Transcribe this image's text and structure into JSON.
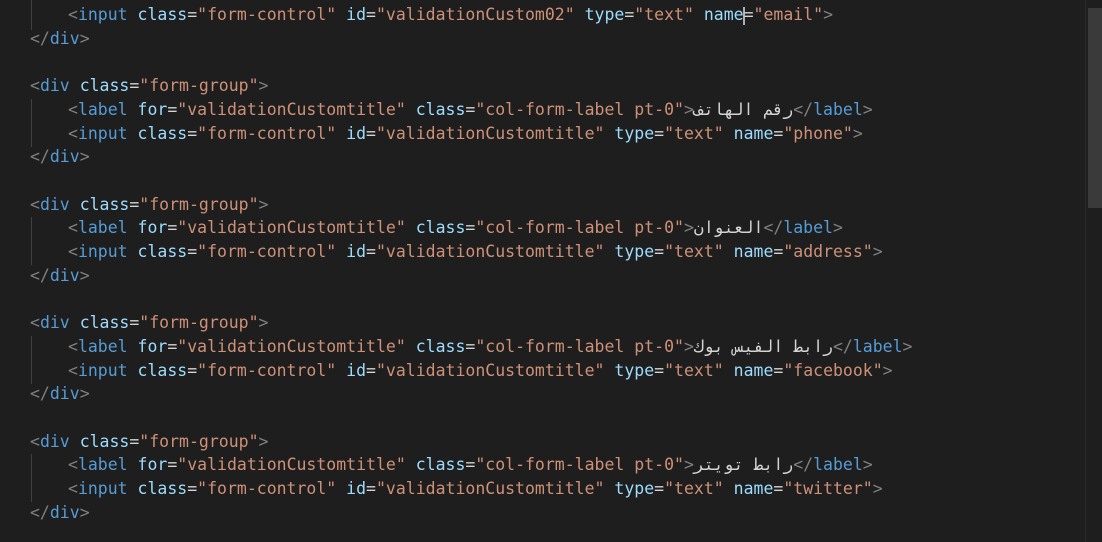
{
  "editor": {
    "theme_colors": {
      "background": "#1e1e1e",
      "tag": "#569cd6",
      "attribute": "#9cdcfe",
      "string": "#ce9178",
      "punctuation": "#808080",
      "text": "#d4d4d4"
    },
    "lines": [
      {
        "indent": 1,
        "parts": [
          [
            "punct",
            "<"
          ],
          [
            "tag",
            "input"
          ],
          [
            "text",
            " "
          ],
          [
            "attr",
            "class"
          ],
          [
            "eq",
            "="
          ],
          [
            "str",
            "\"form-control\""
          ],
          [
            "text",
            " "
          ],
          [
            "attr",
            "id"
          ],
          [
            "eq",
            "="
          ],
          [
            "str",
            "\"validationCustom02\""
          ],
          [
            "text",
            " "
          ],
          [
            "attr",
            "type"
          ],
          [
            "eq",
            "="
          ],
          [
            "str",
            "\"text\""
          ],
          [
            "text",
            " "
          ],
          [
            "attr",
            "name"
          ],
          [
            "eq",
            "="
          ],
          [
            "str",
            "\"email\""
          ],
          [
            "punct",
            ">"
          ]
        ]
      },
      {
        "indent": 0,
        "parts": [
          [
            "punct",
            "</"
          ],
          [
            "tag",
            "div"
          ],
          [
            "punct",
            ">"
          ]
        ]
      },
      {
        "indent": 0,
        "parts": []
      },
      {
        "indent": 0,
        "parts": [
          [
            "punct",
            "<"
          ],
          [
            "tag",
            "div"
          ],
          [
            "text",
            " "
          ],
          [
            "attr",
            "class"
          ],
          [
            "eq",
            "="
          ],
          [
            "str",
            "\"form-group\""
          ],
          [
            "punct",
            ">"
          ]
        ]
      },
      {
        "indent": 1,
        "parts": [
          [
            "punct",
            "<"
          ],
          [
            "tag",
            "label"
          ],
          [
            "text",
            " "
          ],
          [
            "attr",
            "for"
          ],
          [
            "eq",
            "="
          ],
          [
            "str",
            "\"validationCustomtitle\""
          ],
          [
            "text",
            " "
          ],
          [
            "attr",
            "class"
          ],
          [
            "eq",
            "="
          ],
          [
            "str",
            "\"col-form-label pt-0\""
          ],
          [
            "punct",
            ">"
          ],
          [
            "text",
            "رقم الهاتف"
          ],
          [
            "punct",
            "</"
          ],
          [
            "tag",
            "label"
          ],
          [
            "punct",
            ">"
          ]
        ]
      },
      {
        "indent": 1,
        "parts": [
          [
            "punct",
            "<"
          ],
          [
            "tag",
            "input"
          ],
          [
            "text",
            " "
          ],
          [
            "attr",
            "class"
          ],
          [
            "eq",
            "="
          ],
          [
            "str",
            "\"form-control\""
          ],
          [
            "text",
            " "
          ],
          [
            "attr",
            "id"
          ],
          [
            "eq",
            "="
          ],
          [
            "str",
            "\"validationCustomtitle\""
          ],
          [
            "text",
            " "
          ],
          [
            "attr",
            "type"
          ],
          [
            "eq",
            "="
          ],
          [
            "str",
            "\"text\""
          ],
          [
            "text",
            " "
          ],
          [
            "attr",
            "name"
          ],
          [
            "eq",
            "="
          ],
          [
            "str",
            "\"phone\""
          ],
          [
            "punct",
            ">"
          ]
        ]
      },
      {
        "indent": 0,
        "parts": [
          [
            "punct",
            "</"
          ],
          [
            "tag",
            "div"
          ],
          [
            "punct",
            ">"
          ]
        ]
      },
      {
        "indent": 0,
        "parts": []
      },
      {
        "indent": 0,
        "parts": [
          [
            "punct",
            "<"
          ],
          [
            "tag",
            "div"
          ],
          [
            "text",
            " "
          ],
          [
            "attr",
            "class"
          ],
          [
            "eq",
            "="
          ],
          [
            "str",
            "\"form-group\""
          ],
          [
            "punct",
            ">"
          ]
        ]
      },
      {
        "indent": 1,
        "parts": [
          [
            "punct",
            "<"
          ],
          [
            "tag",
            "label"
          ],
          [
            "text",
            " "
          ],
          [
            "attr",
            "for"
          ],
          [
            "eq",
            "="
          ],
          [
            "str",
            "\"validationCustomtitle\""
          ],
          [
            "text",
            " "
          ],
          [
            "attr",
            "class"
          ],
          [
            "eq",
            "="
          ],
          [
            "str",
            "\"col-form-label pt-0\""
          ],
          [
            "punct",
            ">"
          ],
          [
            "text",
            "العنوان"
          ],
          [
            "punct",
            "</"
          ],
          [
            "tag",
            "label"
          ],
          [
            "punct",
            ">"
          ]
        ]
      },
      {
        "indent": 1,
        "parts": [
          [
            "punct",
            "<"
          ],
          [
            "tag",
            "input"
          ],
          [
            "text",
            " "
          ],
          [
            "attr",
            "class"
          ],
          [
            "eq",
            "="
          ],
          [
            "str",
            "\"form-control\""
          ],
          [
            "text",
            " "
          ],
          [
            "attr",
            "id"
          ],
          [
            "eq",
            "="
          ],
          [
            "str",
            "\"validationCustomtitle\""
          ],
          [
            "text",
            " "
          ],
          [
            "attr",
            "type"
          ],
          [
            "eq",
            "="
          ],
          [
            "str",
            "\"text\""
          ],
          [
            "text",
            " "
          ],
          [
            "attr",
            "name"
          ],
          [
            "eq",
            "="
          ],
          [
            "str",
            "\"address\""
          ],
          [
            "punct",
            ">"
          ]
        ]
      },
      {
        "indent": 0,
        "parts": [
          [
            "punct",
            "</"
          ],
          [
            "tag",
            "div"
          ],
          [
            "punct",
            ">"
          ]
        ]
      },
      {
        "indent": 0,
        "parts": []
      },
      {
        "indent": 0,
        "parts": [
          [
            "punct",
            "<"
          ],
          [
            "tag",
            "div"
          ],
          [
            "text",
            " "
          ],
          [
            "attr",
            "class"
          ],
          [
            "eq",
            "="
          ],
          [
            "str",
            "\"form-group\""
          ],
          [
            "punct",
            ">"
          ]
        ]
      },
      {
        "indent": 1,
        "parts": [
          [
            "punct",
            "<"
          ],
          [
            "tag",
            "label"
          ],
          [
            "text",
            " "
          ],
          [
            "attr",
            "for"
          ],
          [
            "eq",
            "="
          ],
          [
            "str",
            "\"validationCustomtitle\""
          ],
          [
            "text",
            " "
          ],
          [
            "attr",
            "class"
          ],
          [
            "eq",
            "="
          ],
          [
            "str",
            "\"col-form-label pt-0\""
          ],
          [
            "punct",
            ">"
          ],
          [
            "text",
            "رابط الفيس بوك"
          ],
          [
            "punct",
            "</"
          ],
          [
            "tag",
            "label"
          ],
          [
            "punct",
            ">"
          ]
        ]
      },
      {
        "indent": 1,
        "parts": [
          [
            "punct",
            "<"
          ],
          [
            "tag",
            "input"
          ],
          [
            "text",
            " "
          ],
          [
            "attr",
            "class"
          ],
          [
            "eq",
            "="
          ],
          [
            "str",
            "\"form-control\""
          ],
          [
            "text",
            " "
          ],
          [
            "attr",
            "id"
          ],
          [
            "eq",
            "="
          ],
          [
            "str",
            "\"validationCustomtitle\""
          ],
          [
            "text",
            " "
          ],
          [
            "attr",
            "type"
          ],
          [
            "eq",
            "="
          ],
          [
            "str",
            "\"text\""
          ],
          [
            "text",
            " "
          ],
          [
            "attr",
            "name"
          ],
          [
            "eq",
            "="
          ],
          [
            "str",
            "\"facebook\""
          ],
          [
            "punct",
            ">"
          ]
        ]
      },
      {
        "indent": 0,
        "parts": [
          [
            "punct",
            "</"
          ],
          [
            "tag",
            "div"
          ],
          [
            "punct",
            ">"
          ]
        ]
      },
      {
        "indent": 0,
        "parts": []
      },
      {
        "indent": 0,
        "parts": [
          [
            "punct",
            "<"
          ],
          [
            "tag",
            "div"
          ],
          [
            "text",
            " "
          ],
          [
            "attr",
            "class"
          ],
          [
            "eq",
            "="
          ],
          [
            "str",
            "\"form-group\""
          ],
          [
            "punct",
            ">"
          ]
        ]
      },
      {
        "indent": 1,
        "parts": [
          [
            "punct",
            "<"
          ],
          [
            "tag",
            "label"
          ],
          [
            "text",
            " "
          ],
          [
            "attr",
            "for"
          ],
          [
            "eq",
            "="
          ],
          [
            "str",
            "\"validationCustomtitle\""
          ],
          [
            "text",
            " "
          ],
          [
            "attr",
            "class"
          ],
          [
            "eq",
            "="
          ],
          [
            "str",
            "\"col-form-label pt-0\""
          ],
          [
            "punct",
            ">"
          ],
          [
            "text",
            "رابط تويتر"
          ],
          [
            "punct",
            "</"
          ],
          [
            "tag",
            "label"
          ],
          [
            "punct",
            ">"
          ]
        ]
      },
      {
        "indent": 1,
        "parts": [
          [
            "punct",
            "<"
          ],
          [
            "tag",
            "input"
          ],
          [
            "text",
            " "
          ],
          [
            "attr",
            "class"
          ],
          [
            "eq",
            "="
          ],
          [
            "str",
            "\"form-control\""
          ],
          [
            "text",
            " "
          ],
          [
            "attr",
            "id"
          ],
          [
            "eq",
            "="
          ],
          [
            "str",
            "\"validationCustomtitle\""
          ],
          [
            "text",
            " "
          ],
          [
            "attr",
            "type"
          ],
          [
            "eq",
            "="
          ],
          [
            "str",
            "\"text\""
          ],
          [
            "text",
            " "
          ],
          [
            "attr",
            "name"
          ],
          [
            "eq",
            "="
          ],
          [
            "str",
            "\"twitter\""
          ],
          [
            "punct",
            ">"
          ]
        ]
      },
      {
        "indent": 0,
        "parts": [
          [
            "punct",
            "</"
          ],
          [
            "tag",
            "div"
          ],
          [
            "punct",
            ">"
          ]
        ]
      }
    ]
  }
}
